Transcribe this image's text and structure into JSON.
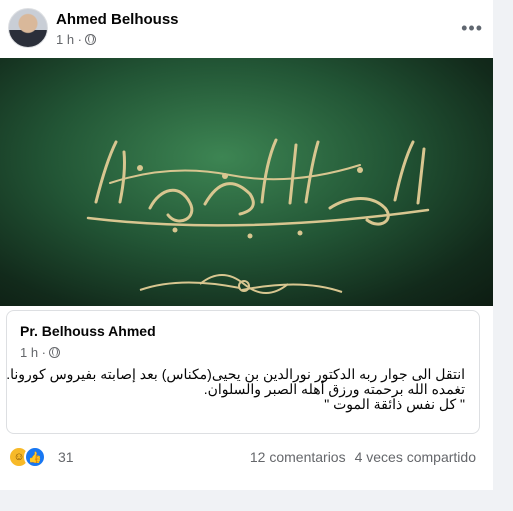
{
  "post": {
    "author": "Ahmed Belhouss",
    "time": "1 h ·",
    "more_label": "•••",
    "banner_text": "إنا لله وإنا إليه راجعون"
  },
  "shared": {
    "author": "Pr. Belhouss Ahmed",
    "time": "1 h ·",
    "lines": [
      "انتقل الى جوار ربه الدكتور نورالدين بن يحيى(مكناس) بعد إصابته  بفيروس كورونا.",
      "تغمده الله برحمته ورزق أهله الصبر والسلوان.",
      "\" كل نفس ذائقة الموت \""
    ]
  },
  "footer": {
    "reaction_count": "31",
    "comments": "12 comentarios",
    "shares": "4 veces compartido",
    "reaction_icons": [
      "care-icon",
      "like-icon"
    ]
  },
  "colors": {
    "banner_green": "#225535",
    "gold": "#d8c690",
    "text_muted": "#65676b"
  }
}
